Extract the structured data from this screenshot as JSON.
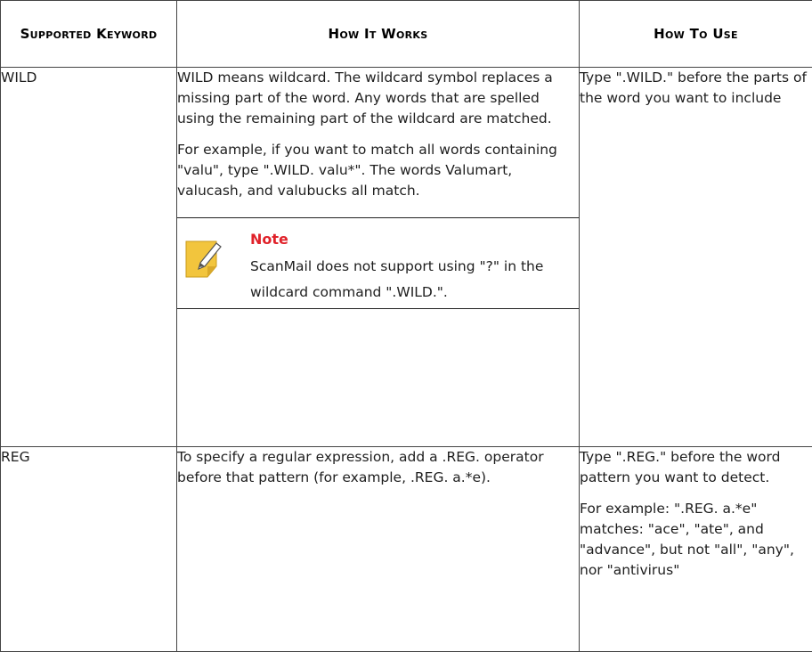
{
  "headers": {
    "keyword": "Supported Keyword",
    "how_it_works": "How It Works",
    "how_to_use": "How To Use"
  },
  "rows": [
    {
      "keyword": "WILD",
      "works_p1": "WILD means wildcard. The wildcard symbol replaces a missing part of the word. Any words that are spelled using the remaining part of the wildcard are matched.",
      "works_p2": "For example, if you want to match all words containing \"valu\", type \".WILD. valu*\". The words Valumart, valucash, and valubucks all match.",
      "note_title": "Note",
      "note_text": "ScanMail does not support using \"?\" in the wildcard command \".WILD.\".",
      "use_p1": "Type \".WILD.\" before the parts of the word you want to include"
    },
    {
      "keyword": "REG",
      "works_p1": "To specify a regular expression, add a .REG. operator before that pattern (for example, .REG. a.*e).",
      "use_p1": "Type \".REG.\" before the word pattern you want to detect.",
      "use_p2": "For example: \".REG. a.*e\" matches: \"ace\", \"ate\", and \"advance\", but not \"all\", \"any\", nor \"antivirus\""
    }
  ],
  "colors": {
    "note_title": "#e0222a",
    "note_icon": "#f2c53d"
  },
  "icons": {
    "note": "note-pencil-icon"
  }
}
